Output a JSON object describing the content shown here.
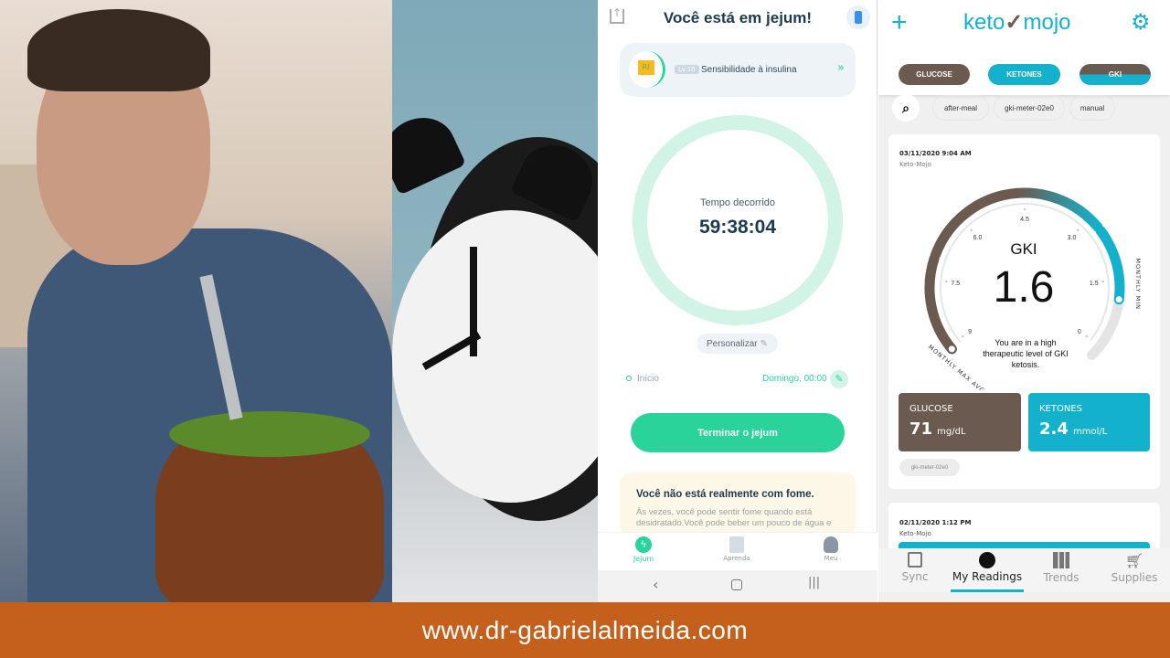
{
  "footer": {
    "url": "www.dr-gabrielalmeida.com"
  },
  "photos": {
    "left": "man-with-mate-gourd",
    "middle": "alarm-clock"
  },
  "fasting_app": {
    "title": "Você está em jejum!",
    "stage": {
      "badge": "RI",
      "level": "Lv.10",
      "label": "Sensibilidade à insulina"
    },
    "timer": {
      "label": "Tempo decorrido",
      "value": "59:38:04",
      "progress_percent": 100
    },
    "customize_label": "Personalizar",
    "start": {
      "label": "Início",
      "value": "Domingo, 00:00"
    },
    "end_button": "Terminar o jejum",
    "tip": {
      "title": "Você não está realmente com fome.",
      "body": "Às vezes, você pode sentir fome quando está desidratado.Você pode beber um pouco de água e"
    },
    "nav": [
      {
        "label": "Jejum",
        "active": true
      },
      {
        "label": "Aprenda"
      },
      {
        "label": "Meu"
      }
    ],
    "colors": {
      "accent": "#2ad39a",
      "title": "#1d3b50"
    }
  },
  "keto_app": {
    "logo": "keto mojo",
    "type_tabs": [
      "GLUCOSE",
      "KETONES",
      "GKI"
    ],
    "filters": [
      "after-meal",
      "gki-meter-02e0",
      "manual"
    ],
    "reading": {
      "datetime": "03/11/2020 9:04 AM",
      "source": "Keto-Mojo",
      "gauge_title": "GKI",
      "gki": "1.6",
      "ticks": [
        "9",
        "7.5",
        "6.0",
        "4.5",
        "3.0",
        "1.5",
        "0"
      ],
      "max_label": "MONTHLY MAX AVG",
      "min_label": "MONTHLY MIN",
      "message": "You are in a high therapeutic level of GKI ketosis.",
      "glucose": {
        "label": "GLUCOSE",
        "value": "71",
        "unit": "mg/dL"
      },
      "ketones": {
        "label": "KETONES",
        "value": "2.4",
        "unit": "mmol/L"
      },
      "tag": "gki-meter-02e0"
    },
    "next_reading": {
      "datetime": "02/11/2020 1:12 PM",
      "source": "Keto-Mojo"
    },
    "nav": [
      {
        "label": "Sync"
      },
      {
        "label": "My Readings",
        "active": true
      },
      {
        "label": "Trends"
      },
      {
        "label": "Supplies"
      }
    ],
    "colors": {
      "brown": "#6b5a4f",
      "teal": "#14b1cc"
    }
  }
}
